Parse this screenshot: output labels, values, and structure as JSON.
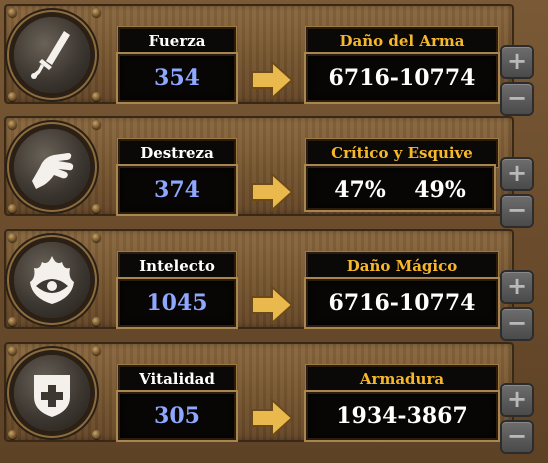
{
  "stats": [
    {
      "name": "Fuerza",
      "value": "354",
      "derived_label": "Daño del Arma",
      "derived_value": "6716-10774",
      "icon": "sword-icon"
    },
    {
      "name": "Destreza",
      "value": "374",
      "derived_label": "Crítico y Esquive",
      "derived_values": [
        "47%",
        "49%"
      ],
      "icon": "hand-icon"
    },
    {
      "name": "Intelecto",
      "value": "1045",
      "derived_label": "Daño Mágico",
      "derived_value": "6716-10774",
      "icon": "flaming-eye-icon"
    },
    {
      "name": "Vitalidad",
      "value": "305",
      "derived_label": "Armadura",
      "derived_value": "1934-3867",
      "icon": "shield-cross-icon"
    }
  ],
  "buttons": {
    "plus": "+",
    "minus": "−"
  },
  "colors": {
    "stat_value": "#8fa8ff",
    "derived_label": "#f6b82a",
    "arrow": "#e9b94e"
  }
}
